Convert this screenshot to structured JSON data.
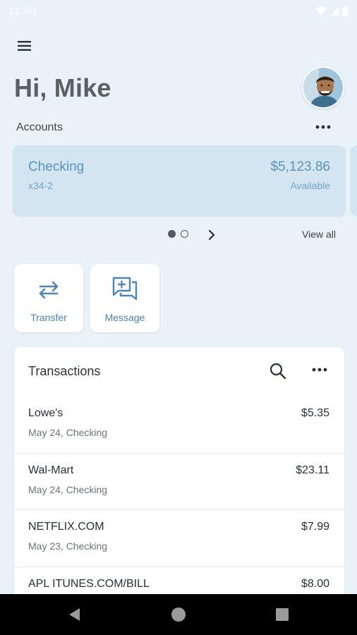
{
  "status_bar": {
    "time": "11:30"
  },
  "header": {
    "greeting": "Hi, Mike"
  },
  "accounts": {
    "label": "Accounts",
    "card": {
      "name": "Checking",
      "number": "x34-2",
      "balance": "$5,123.86",
      "balance_label": "Available"
    },
    "pager": {
      "count": 2,
      "active": 1
    },
    "view_all": "View all"
  },
  "actions": [
    {
      "label": "Transfer",
      "icon": "transfer-arrows-icon"
    },
    {
      "label": "Message",
      "icon": "message-plus-icon"
    }
  ],
  "transactions": {
    "title": "Transactions",
    "items": [
      {
        "merchant": "Lowe's",
        "meta": "May 24, Checking",
        "amount": "$5.35"
      },
      {
        "merchant": "Wal-Mart",
        "meta": "May 24, Checking",
        "amount": "$23.11"
      },
      {
        "merchant": "NETFLIX.COM",
        "meta": "May 23, Checking",
        "amount": "$7.99"
      },
      {
        "merchant": "APL ITUNES.COM/BILL",
        "meta": "",
        "amount": "$8.00"
      }
    ]
  },
  "colors": {
    "background": "#eaf2f9",
    "card": "#d3e5f1",
    "accent": "#4e86b2",
    "nav_bar": "#000000"
  }
}
